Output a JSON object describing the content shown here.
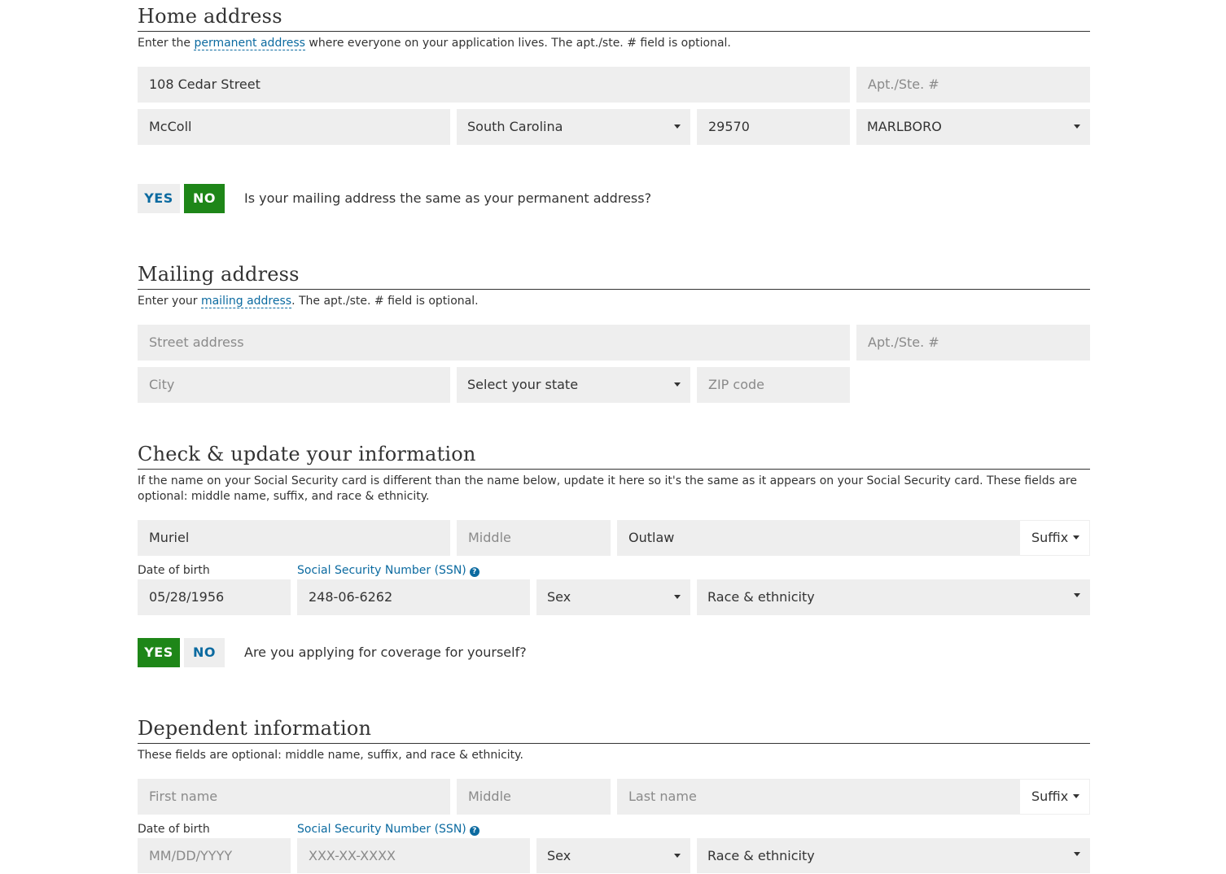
{
  "home": {
    "title": "Home address",
    "help_pre": "Enter the ",
    "help_link": "permanent address",
    "help_post": " where everyone on your application lives. The apt./ste. # field is optional.",
    "street_value": "108 Cedar Street",
    "apt_placeholder": "Apt./Ste. #",
    "city_value": "McColl",
    "state_value": "South Carolina",
    "zip_value": "29570",
    "county_value": "MARLBORO"
  },
  "mailing_question": {
    "yes": "YES",
    "no": "NO",
    "selected": "NO",
    "text": "Is your mailing address the same as your permanent address?"
  },
  "mailing": {
    "title": "Mailing address",
    "help_pre": "Enter your ",
    "help_link": "mailing address",
    "help_post": ". The apt./ste. # field is optional.",
    "street_placeholder": "Street address",
    "apt_placeholder": "Apt./Ste. #",
    "city_placeholder": "City",
    "state_placeholder": "Select your state",
    "zip_placeholder": "ZIP code"
  },
  "info": {
    "title": "Check & update your information",
    "help": "If the name on your Social Security card is different than the name below, update it here so it's the same as it appears on your Social Security card. These fields are optional: middle name, suffix, and race & ethnicity.",
    "first_value": "Muriel",
    "middle_placeholder": "Middle",
    "last_value": "Outlaw",
    "suffix_label": "Suffix",
    "dob_label": "Date of birth",
    "dob_value": "05/28/1956",
    "ssn_label": "Social Security Number (SSN)",
    "ssn_value": "248-06-6262",
    "sex_label": "Sex",
    "race_label": "Race & ethnicity"
  },
  "coverage_question": {
    "yes": "YES",
    "no": "NO",
    "selected": "YES",
    "text": "Are you applying for coverage for yourself?"
  },
  "dependent": {
    "title": "Dependent information",
    "help": "These fields are optional: middle name, suffix, and race & ethnicity.",
    "first_placeholder": "First name",
    "middle_placeholder": "Middle",
    "last_placeholder": "Last name",
    "suffix_label": "Suffix",
    "dob_label": "Date of birth",
    "dob_placeholder": "MM/DD/YYYY",
    "ssn_label": "Social Security Number (SSN)",
    "ssn_placeholder": "XXX-XX-XXXX",
    "sex_label": "Sex",
    "race_label": "Race & ethnicity"
  },
  "colors": {
    "field_bg": "#eeeeee",
    "link_blue": "#0b6aa0",
    "selected_green": "#1e8618"
  },
  "icons": [
    "chevron-down-icon",
    "help-circle-icon"
  ]
}
